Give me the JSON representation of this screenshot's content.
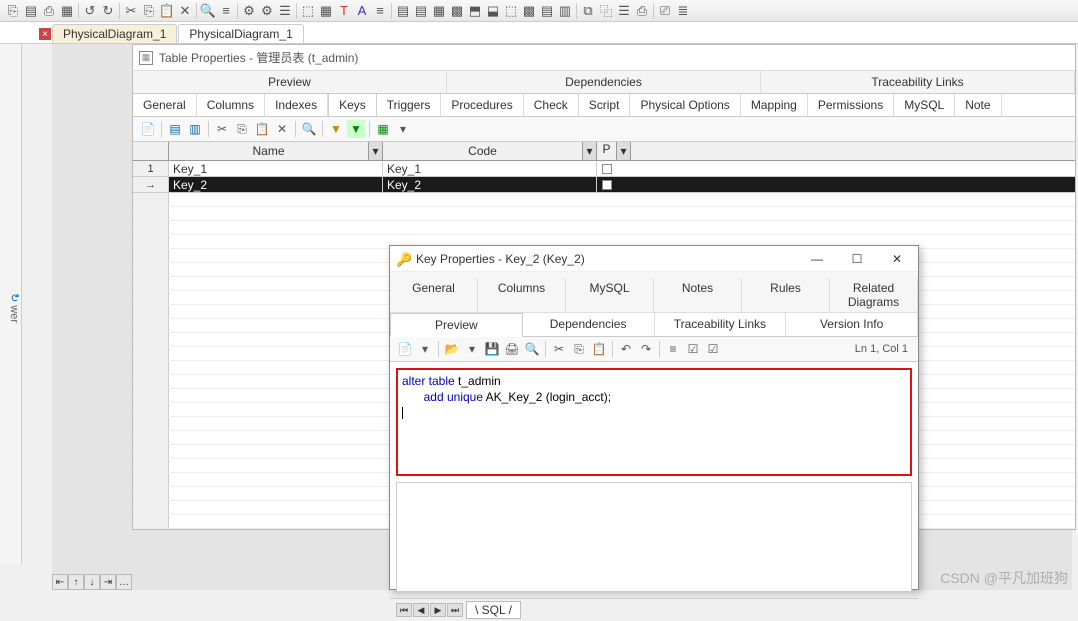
{
  "app_toolbar_icons": [
    "⎘",
    "⎘",
    "▦",
    "✎",
    "▤",
    "↺",
    "↻",
    "✂",
    "⎘",
    "⎙",
    "✕",
    "🔍",
    "≡",
    "⚙",
    "☰",
    "⬚",
    "▦",
    "⫿",
    "T",
    "A",
    "≡",
    "▤",
    "▦",
    "▩",
    "≣",
    "▤",
    "⬒",
    "⬓",
    "⬚",
    "▩",
    "▤",
    "▥",
    "⧉",
    "⿻",
    "☰",
    "⎙",
    "⎚"
  ],
  "doc_tabs": [
    "PhysicalDiagram_1",
    "PhysicalDiagram_1"
  ],
  "sidebar_label": "wer",
  "table_props_title": "Table Properties - 管理员表 (t_admin)",
  "mega_tabs1": [
    "Preview",
    "Dependencies",
    "Traceability Links"
  ],
  "mega_tabs2": [
    "General",
    "Columns",
    "Indexes",
    "Keys",
    "Triggers",
    "Procedures",
    "Check",
    "Script",
    "Physical Options",
    "Mapping",
    "Permissions",
    "MySQL",
    "Note"
  ],
  "mega_tabs2_active": 3,
  "grid_headers": {
    "name": "Name",
    "code": "Code",
    "p": "P"
  },
  "grid_rows": [
    {
      "num": "1",
      "name": "Key_1",
      "code": "Key_1",
      "p": false
    },
    {
      "num": "→",
      "name": "Key_2",
      "code": "Key_2",
      "p": false,
      "sel": true
    }
  ],
  "key_dialog_title": "Key Properties - Key_2 (Key_2)",
  "kd_tabs1": [
    "General",
    "Columns",
    "MySQL",
    "Notes",
    "Rules",
    "Related Diagrams"
  ],
  "kd_tabs2": [
    "Preview",
    "Dependencies",
    "Traceability Links",
    "Version Info"
  ],
  "kd_tabs2_active": 0,
  "kd_status": "Ln 1, Col 1",
  "kd_sql_kw1": "alter table",
  "kd_sql_t": " t_admin",
  "kd_sql_kw2": "add unique",
  "kd_sql_rest": " AK_Key_2 (login_acct);",
  "kd_bottom_tab": "SQL",
  "watermark": "CSDN @平凡加班狗"
}
